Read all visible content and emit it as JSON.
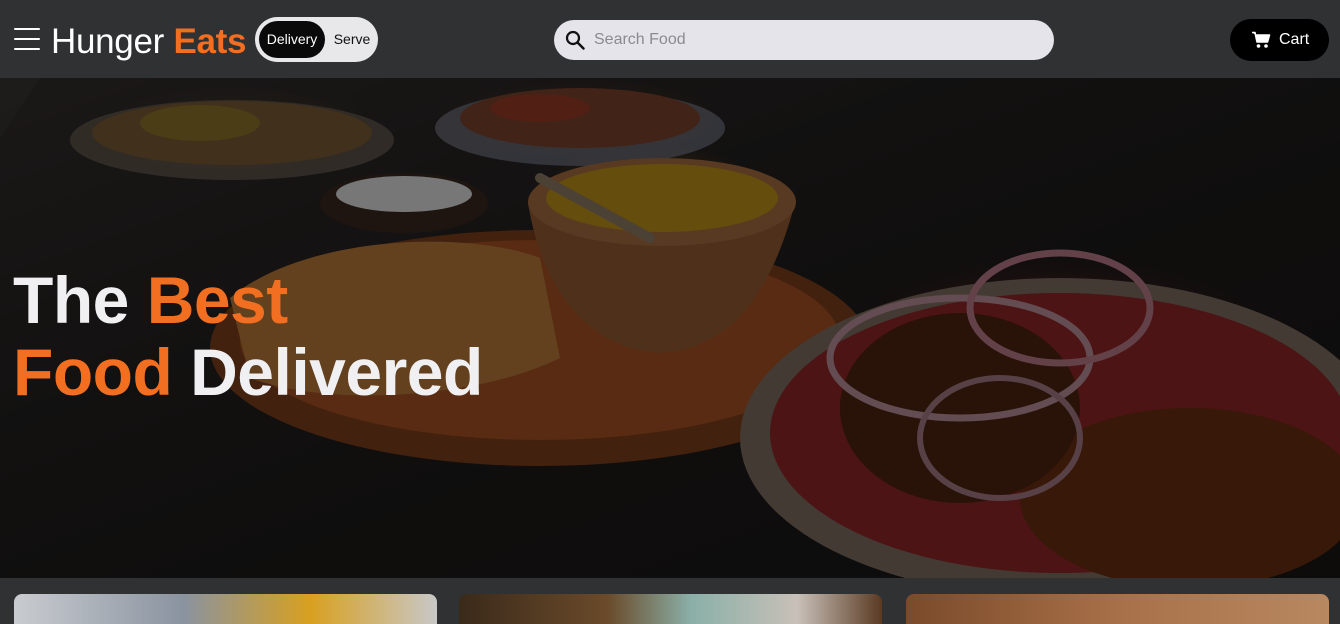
{
  "header": {
    "brand_part1": "Hunger",
    "brand_part2": "Eats",
    "toggle": {
      "active": "Delivery",
      "inactive": "Serve"
    },
    "search": {
      "placeholder": "Search Food",
      "value": ""
    },
    "cart_label": "Cart",
    "icons": {
      "menu": "hamburger-menu-icon",
      "search": "search-icon",
      "cart": "cart-icon"
    }
  },
  "hero": {
    "line1_word1": "The",
    "line1_word2": "Best",
    "line2_word1": "Food",
    "line2_word2": "Delivered"
  },
  "cards": [
    {
      "name": "food-card-1"
    },
    {
      "name": "food-card-2"
    },
    {
      "name": "food-card-3"
    }
  ],
  "colors": {
    "accent": "#f26f21",
    "navbar": "#303133",
    "search_bg": "#e4e4ea",
    "cart_bg": "#000000",
    "toggle_active_bg": "#0a0a0a"
  }
}
